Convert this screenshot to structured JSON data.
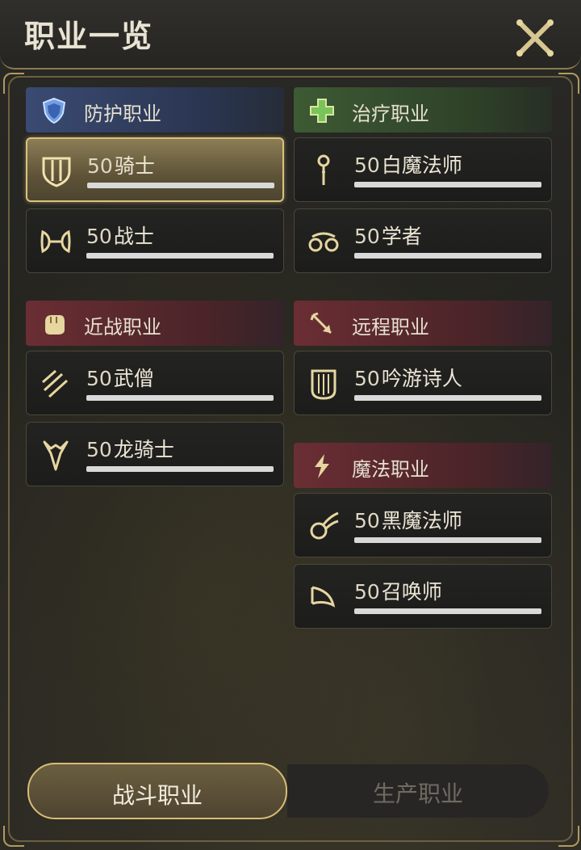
{
  "window": {
    "title": "职业一览"
  },
  "categories": {
    "tank": {
      "label": "防护职业",
      "icon": "shield-icon"
    },
    "healer": {
      "label": "治疗职业",
      "icon": "cross-icon"
    },
    "melee": {
      "label": "近战职业",
      "icon": "fist-icon"
    },
    "ranged": {
      "label": "远程职业",
      "icon": "arrow-icon"
    },
    "magic": {
      "label": "魔法职业",
      "icon": "lightning-icon"
    }
  },
  "jobs": {
    "paladin": {
      "level": "50",
      "name": "骑士",
      "icon": "paladin-shield-icon",
      "selected": true
    },
    "warrior": {
      "level": "50",
      "name": "战士",
      "icon": "warrior-axe-icon"
    },
    "white_mage": {
      "level": "50",
      "name": "白魔法师",
      "icon": "white-mage-staff-icon"
    },
    "scholar": {
      "level": "50",
      "name": "学者",
      "icon": "scholar-icon"
    },
    "monk": {
      "level": "50",
      "name": "武僧",
      "icon": "monk-claw-icon"
    },
    "dragoon": {
      "level": "50",
      "name": "龙骑士",
      "icon": "dragoon-icon"
    },
    "bard": {
      "level": "50",
      "name": "吟游诗人",
      "icon": "bard-harp-icon"
    },
    "black_mage": {
      "level": "50",
      "name": "黑魔法师",
      "icon": "black-mage-fireball-icon"
    },
    "summoner": {
      "level": "50",
      "name": "召唤师",
      "icon": "summoner-icon"
    }
  },
  "tabs": {
    "combat": "战斗职业",
    "crafting": "生产职业",
    "active": "combat"
  },
  "colors": {
    "accent_gold": "#d7bd77",
    "tank": "#3a4a72",
    "healer": "#3d5a34",
    "dps": "#6a2e34"
  }
}
